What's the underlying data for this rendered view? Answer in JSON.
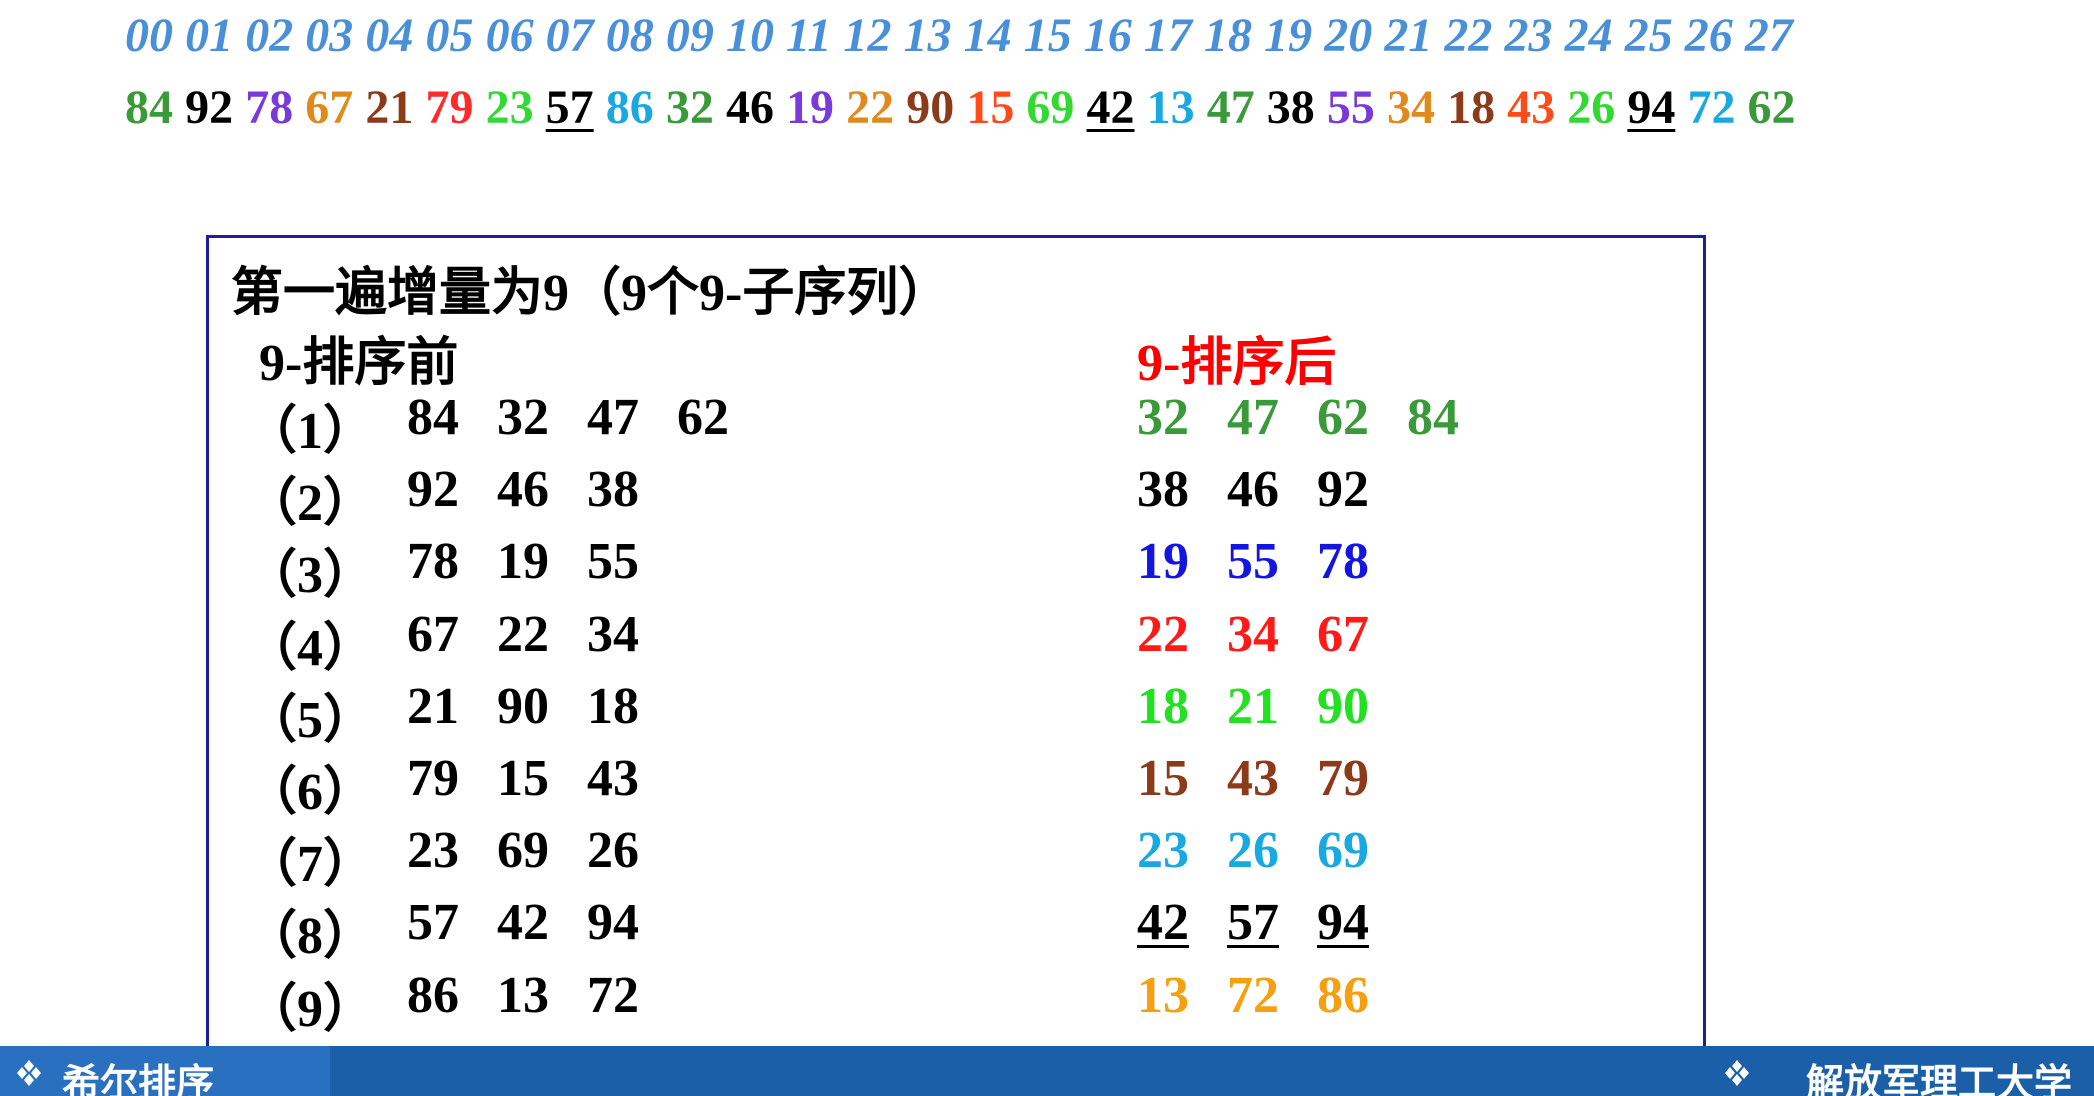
{
  "indices": [
    "00",
    "01",
    "02",
    "03",
    "04",
    "05",
    "06",
    "07",
    "08",
    "09",
    "10",
    "11",
    "12",
    "13",
    "14",
    "15",
    "16",
    "17",
    "18",
    "19",
    "20",
    "21",
    "22",
    "23",
    "24",
    "25",
    "26",
    "27"
  ],
  "values": [
    {
      "v": "84",
      "color": "#3a9a3a",
      "u": false
    },
    {
      "v": "92",
      "color": "#000000",
      "u": false
    },
    {
      "v": "78",
      "color": "#7a3ad9",
      "u": false
    },
    {
      "v": "67",
      "color": "#e08a1e",
      "u": false
    },
    {
      "v": "21",
      "color": "#8b3a1a",
      "u": false
    },
    {
      "v": "79",
      "color": "#ff2a2a",
      "u": false
    },
    {
      "v": "23",
      "color": "#33d933",
      "u": false
    },
    {
      "v": "57",
      "color": "#000000",
      "u": true
    },
    {
      "v": "86",
      "color": "#1aa8e0",
      "u": false
    },
    {
      "v": "32",
      "color": "#3a9a3a",
      "u": false
    },
    {
      "v": "46",
      "color": "#000000",
      "u": false
    },
    {
      "v": "19",
      "color": "#7a3ad9",
      "u": false
    },
    {
      "v": "22",
      "color": "#e08a1e",
      "u": false
    },
    {
      "v": "90",
      "color": "#8b3a1a",
      "u": false
    },
    {
      "v": "15",
      "color": "#ff4a1a",
      "u": false
    },
    {
      "v": "69",
      "color": "#33d933",
      "u": false
    },
    {
      "v": "42",
      "color": "#000000",
      "u": true
    },
    {
      "v": "13",
      "color": "#1aa8e0",
      "u": false
    },
    {
      "v": "47",
      "color": "#3a9a3a",
      "u": false
    },
    {
      "v": "38",
      "color": "#000000",
      "u": false
    },
    {
      "v": "55",
      "color": "#7a3ad9",
      "u": false
    },
    {
      "v": "34",
      "color": "#e08a1e",
      "u": false
    },
    {
      "v": "18",
      "color": "#8b3a1a",
      "u": false
    },
    {
      "v": "43",
      "color": "#ff4a1a",
      "u": false
    },
    {
      "v": "26",
      "color": "#33d933",
      "u": false
    },
    {
      "v": "94",
      "color": "#000000",
      "u": true
    },
    {
      "v": "72",
      "color": "#1aa8e0",
      "u": false
    },
    {
      "v": "62",
      "color": "#3a9a3a",
      "u": false
    }
  ],
  "box": {
    "title": "第一遍增量为9（9个9-子序列）",
    "before_label": "9-排序前",
    "after_label": "9-排序后",
    "rows": [
      {
        "label": "（1）",
        "before": [
          "84",
          "32",
          "47",
          "62"
        ],
        "after": [
          "32",
          "47",
          "62",
          "84"
        ],
        "color": "#3a9a3a",
        "underline": false
      },
      {
        "label": "（2）",
        "before": [
          "92",
          "46",
          "38"
        ],
        "after": [
          "38",
          "46",
          "92"
        ],
        "color": "#000000",
        "underline": false
      },
      {
        "label": "（3）",
        "before": [
          "78",
          "19",
          "55"
        ],
        "after": [
          "19",
          "55",
          "78"
        ],
        "color": "#1515e0",
        "underline": false
      },
      {
        "label": "（4）",
        "before": [
          "67",
          "22",
          "34"
        ],
        "after": [
          "22",
          "34",
          "67"
        ],
        "color": "#ff1a1a",
        "underline": false
      },
      {
        "label": "（5）",
        "before": [
          "21",
          "90",
          "18"
        ],
        "after": [
          "18",
          "21",
          "90"
        ],
        "color": "#22e022",
        "underline": false
      },
      {
        "label": "（6）",
        "before": [
          "79",
          "15",
          "43"
        ],
        "after": [
          "15",
          "43",
          "79"
        ],
        "color": "#8b3a1a",
        "underline": false
      },
      {
        "label": "（7）",
        "before": [
          "23",
          "69",
          "26"
        ],
        "after": [
          "23",
          "26",
          "69"
        ],
        "color": "#1aa8e0",
        "underline": false
      },
      {
        "label": "（8）",
        "before": [
          "57",
          "42",
          "94"
        ],
        "after": [
          "42",
          "57",
          "94"
        ],
        "color": "#000000",
        "underline": true
      },
      {
        "label": "（9）",
        "before": [
          "86",
          "13",
          "72"
        ],
        "after": [
          "13",
          "72",
          "86"
        ],
        "color": "#f5a010",
        "underline": false
      }
    ]
  },
  "footer": {
    "left_text": "希尔排序",
    "right_text": "解放军理工大学",
    "icon": "diamond-cluster-icon"
  }
}
